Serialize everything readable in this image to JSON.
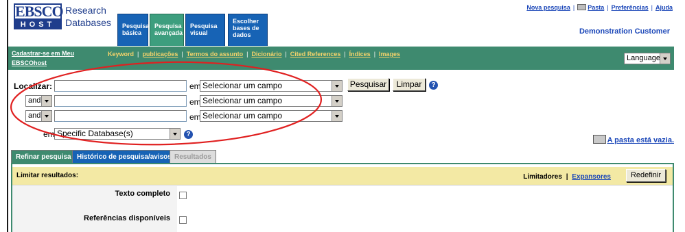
{
  "logo": {
    "brand": "EBSCO",
    "host": "HOST",
    "line1": "Research",
    "line2": "Databases"
  },
  "tabs": [
    {
      "label": "Pesquisa básica"
    },
    {
      "label": "Pesquisa avançada"
    },
    {
      "label": "Pesquisa visual"
    },
    {
      "label": "Escolher bases de dados"
    }
  ],
  "top_links": {
    "new_search": "Nova pesquisa",
    "folder": "Pasta",
    "preferences": "Preferências",
    "help": "Ajuda"
  },
  "customer": "Demonstration Customer",
  "toolbar": {
    "register": "Cadastrar-se em Meu EBSCOhost",
    "links": [
      "Keyword",
      "publicações",
      "Termos do assunto",
      "Dicionário",
      "Cited References",
      "Índices",
      "Images"
    ],
    "language": "Language"
  },
  "search": {
    "find_label": "Localizar:",
    "in_label": "em",
    "field_placeholder": "Selecionar um campo",
    "boolean": "and",
    "search_button": "Pesquisar",
    "clear_button": "Limpar",
    "help_glyph": "?",
    "db_label": "em",
    "db_value": "Specific Database(s)"
  },
  "folder_status": "A pasta está vazia.",
  "bottom_tabs": [
    "Refinar pesquisa",
    "Histórico de pesquisa/avisos",
    "Resultados"
  ],
  "refine": {
    "limit_title": "Limitar resultados:",
    "limiters": "Limitadores",
    "expanders": "Expansores",
    "reset_button": "Redefinir",
    "options": [
      "Texto completo",
      "Referências disponíveis"
    ]
  },
  "colors": {
    "green": "#3e8a6f",
    "blue": "#1763b5",
    "link": "#1a46b8",
    "annotation": "#e02020"
  }
}
